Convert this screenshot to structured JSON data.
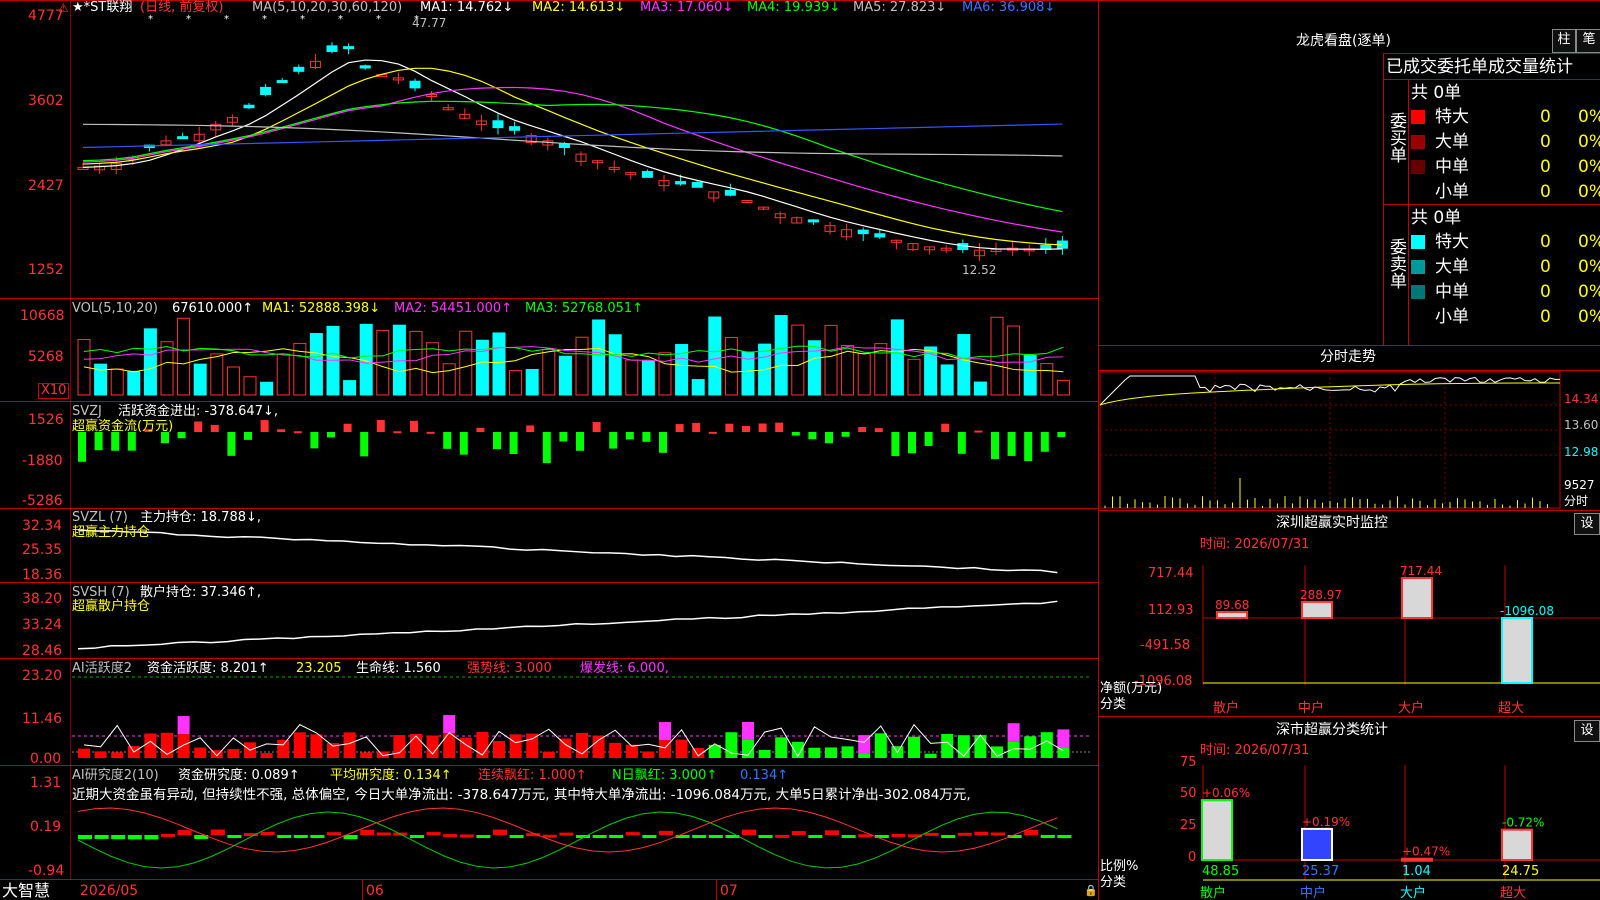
{
  "colors": {
    "up": "#ff3333",
    "down": "#00ffff",
    "grid": "#c00000",
    "vol_green": "#00ff00"
  },
  "main_chart": {
    "header": {
      "star": "★*ST联翔",
      "period": "(日线, 前复权)",
      "ma_label": "MA(5,10,20,30,60,120)",
      "ma1": "MA1: 14.762↓",
      "ma2": "MA2: 14.613↓",
      "ma3": "MA3: 17.060↓",
      "ma4": "MA4: 19.939↓",
      "ma5": "MA5: 27.823↓",
      "ma6": "MA6: 36.908↓"
    },
    "yticks": [
      "4777",
      "3602",
      "2427",
      "1252"
    ],
    "high_label": "47.77",
    "low_label": "12.52"
  },
  "vol_panel": {
    "header": {
      "name": "VOL(5,10,20)",
      "val": "67610.000↑",
      "ma1": "MA1: 52888.398↓",
      "ma2": "MA2: 54451.000↑",
      "ma3": "MA3: 52768.051↑"
    },
    "yticks": [
      "10668",
      "5268"
    ],
    "unit": "X10"
  },
  "svzj_panel": {
    "header": {
      "name": "SVZJ",
      "text": "活跃资金进出: -378.647↓,"
    },
    "sub": "超赢资金流(万元)",
    "yticks": [
      "1526",
      "-1880",
      "-5286"
    ]
  },
  "svzl_panel": {
    "header": {
      "name": "SVZL (7)",
      "text": "主力持仓: 18.788↓,"
    },
    "sub": "超赢主力持仓",
    "yticks": [
      "32.34",
      "25.35",
      "18.36"
    ]
  },
  "svsh_panel": {
    "header": {
      "name": "SVSH (7)",
      "text": "散户持仓: 37.346↑,"
    },
    "sub": "超赢散户持仓",
    "yticks": [
      "38.20",
      "33.24",
      "28.46"
    ]
  },
  "ai_active": {
    "header": {
      "name": "AI活跃度2",
      "a": "资金活跃度: 8.201↑",
      "b": "23.205",
      "c": "生命线: 1.560",
      "d": "强势线: 3.000",
      "e": "爆发线: 6.000,"
    },
    "yticks": [
      "23.20",
      "11.46",
      "0.00"
    ]
  },
  "ai_research": {
    "header": {
      "name": "AI研究度2(10)",
      "a": "资金研究度: 0.089↑",
      "b": "平均研究度: 0.134↑",
      "c": "连续飘红: 1.000↑",
      "d": "N日飘红: 3.000↑",
      "e": "0.134↑"
    },
    "comment": "近期大资金虽有异动, 但持续性不强, 总体偏空, 今日大单净流出: -378.647万元, 其中特大单净流出: -1096.084万元, 大单5日累计净出-302.084万元,",
    "yticks": [
      "1.31",
      "0.19",
      "-0.94"
    ]
  },
  "bottom_axis": {
    "brand": "大智慧",
    "dates": [
      "2026/05",
      "06",
      "07"
    ]
  },
  "dragon_tiger": {
    "title": "龙虎看盘(逐单)",
    "btn_bar": "柱",
    "btn_pen": "笔",
    "subtitle": "已成交委托单成交量统计",
    "buy": {
      "label": "委买单",
      "total": "共 0单",
      "rows": [
        {
          "name": "特大",
          "count": "0",
          "pct": "0%",
          "color": "#ff0000"
        },
        {
          "name": "大单",
          "count": "0",
          "pct": "0%",
          "color": "#990000"
        },
        {
          "name": "中单",
          "count": "0",
          "pct": "0%",
          "color": "#660000"
        },
        {
          "name": "小单",
          "count": "0",
          "pct": "0%",
          "color": "#000000"
        }
      ]
    },
    "sell": {
      "label": "委卖单",
      "total": "共 0单",
      "rows": [
        {
          "name": "特大",
          "count": "0",
          "pct": "0%",
          "color": "#00ffff"
        },
        {
          "name": "大单",
          "count": "0",
          "pct": "0%",
          "color": "#009999"
        },
        {
          "name": "中单",
          "count": "0",
          "pct": "0%",
          "color": "#007777"
        },
        {
          "name": "小单",
          "count": "0",
          "pct": "0%",
          "color": "#000000"
        }
      ]
    }
  },
  "intraday": {
    "title": "分时走势",
    "yticks": [
      "14.34",
      "13.60",
      "12.98"
    ],
    "vol": "9527",
    "vol_unit": "分时"
  },
  "monitor": {
    "title": "深圳超赢实时监控",
    "btn": "设",
    "time": "时间: 2026/07/31",
    "yticks": [
      "717.44",
      "112.93",
      "-491.58",
      "-1096.08"
    ],
    "ylabel": "净额(万元)",
    "xlabel": "分类",
    "chart_data": {
      "type": "bar",
      "categories": [
        "散户",
        "中户",
        "大户",
        "超大"
      ],
      "values": [
        89.68,
        288.97,
        717.44,
        -1096.08
      ],
      "ylim": [
        -1096.08,
        717.44
      ]
    }
  },
  "classify": {
    "title": "深市超赢分类统计",
    "btn": "设",
    "time": "时间: 2026/07/31",
    "yticks": [
      "75",
      "50",
      "25",
      "0"
    ],
    "ylabel": "比例%",
    "xlabel": "分类",
    "chart_data": {
      "type": "bar",
      "categories": [
        "散户",
        "中户",
        "大户",
        "超大"
      ],
      "values": [
        48.85,
        25.37,
        1.04,
        24.75
      ],
      "changes": [
        "+0.06%",
        "+0.19%",
        "+0.47%",
        "-0.72%"
      ],
      "ylim": [
        0,
        75
      ]
    }
  }
}
